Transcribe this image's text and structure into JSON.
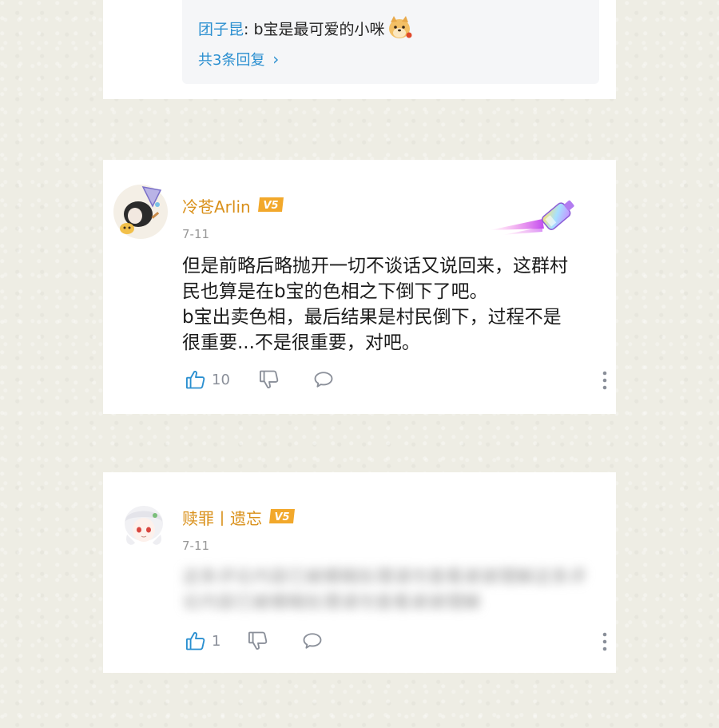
{
  "top_card": {
    "reply_user": "团子昆",
    "reply_sep": ": ",
    "reply_text": "b宝是最可爱的小咪",
    "reply_count_label": "共3条回复",
    "reply_chevron": "›"
  },
  "comments": [
    {
      "username": "冷苍Arlin",
      "vip_label": "V5",
      "date": "7-11",
      "lines": [
        "但是前略后略抛开一切不谈话又说回来，这群村",
        "民也算是在b宝的色相之下倒下了吧。",
        "b宝出卖色相，最后结果是村民倒下，过程不是",
        "很重要...不是很重要，对吧。"
      ],
      "like_count": "10"
    },
    {
      "username": "赎罪丨遗忘",
      "vip_label": "V5",
      "date": "7-11",
      "blurred_text": "这条评论内容已被模糊处理请勿查看谢谢理解这条评论内容已被模糊处理请勿查看谢谢理解",
      "like_count": "1"
    }
  ],
  "colors": {
    "accent": "#2a8fd0",
    "username": "#d9901a",
    "muted": "#8a8f99",
    "page_bg": "#eeede4"
  },
  "icons": [
    "thumbs-up-icon",
    "thumbs-down-icon",
    "comment-icon",
    "more-vertical-icon",
    "doge-emoji-icon",
    "paintbrush-decoration-icon"
  ]
}
